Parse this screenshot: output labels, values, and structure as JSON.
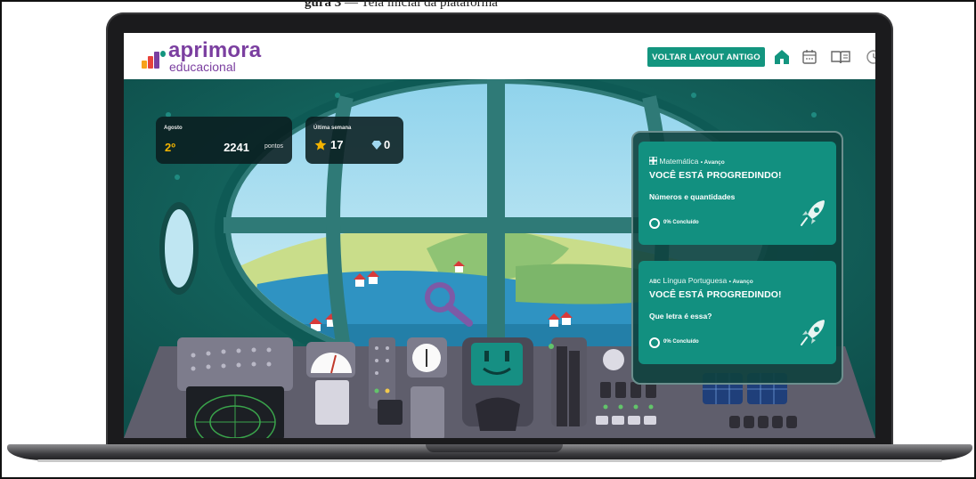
{
  "page_heading": {
    "bold": "gura 3",
    "rest": "— Tela inicial da plataforma"
  },
  "logo": {
    "name": "aprimora",
    "subtitle": "educacional",
    "bar_colors": [
      "#f7a21b",
      "#e8433b",
      "#7b3fa0",
      "#13957f"
    ]
  },
  "header": {
    "old_layout_button": "VOLTAR LAYOUT ANTIGO",
    "nav_icons": [
      "home-icon",
      "calendar-icon",
      "book-icon",
      "clock-icon"
    ],
    "accent_color": "#13957f"
  },
  "ranking_card": {
    "month_label": "Agosto",
    "position": "2º",
    "points": "2241",
    "points_unit": "pontos"
  },
  "week_card": {
    "label": "Última semana",
    "stars": "17",
    "gems": "0"
  },
  "courses": [
    {
      "subject_icon": "grid-icon",
      "subject": "Matemática",
      "level": "Avanço",
      "status": "VOCÊ ESTÁ PROGREDINDO!",
      "lesson": "Números e quantidades",
      "progress_text": "0% Concluído",
      "progress": 0
    },
    {
      "subject_icon": "abc-icon",
      "subject_badge": "ABC",
      "subject": "Língua Portuguesa",
      "level": "Avanço",
      "status": "VOCÊ ESTÁ PROGREDINDO!",
      "lesson": "Que letra é essa?",
      "progress_text": "0% Concluído",
      "progress": 0
    }
  ],
  "colors": {
    "scene_teal": "#13645e",
    "card_green": "#129080",
    "star": "#f4b400",
    "gem": "#9fd7f0"
  }
}
